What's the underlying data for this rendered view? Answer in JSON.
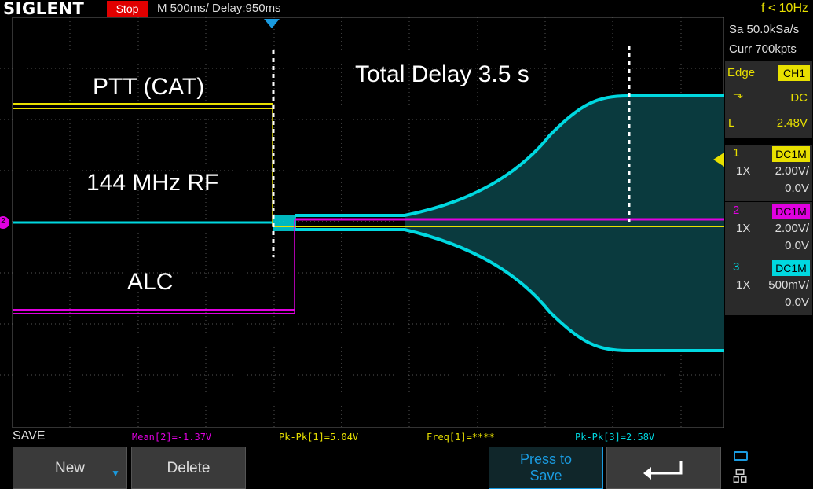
{
  "topbar": {
    "brand": "SIGLENT",
    "run_state": "Stop",
    "timebase": "M 500ms/  Delay:950ms",
    "trigger_freq": "f < 10Hz"
  },
  "acquisition": {
    "sample_rate": "Sa 50.0kSa/s",
    "memory_depth": "Curr 700kpts"
  },
  "trigger": {
    "type": "Edge",
    "source": "CH1",
    "coupling": "DC",
    "level_label": "L",
    "level": "2.48V"
  },
  "channels": [
    {
      "num": "1",
      "coupling": "DC1M",
      "probe": "1X",
      "vdiv": "2.00V/",
      "offset": "0.0V",
      "color": "#e8e000"
    },
    {
      "num": "2",
      "coupling": "DC1M",
      "probe": "1X",
      "vdiv": "2.00V/",
      "offset": "0.0V",
      "color": "#e000e0"
    },
    {
      "num": "3",
      "coupling": "DC1M",
      "probe": "1X",
      "vdiv": "500mV/",
      "offset": "0.0V",
      "color": "#00d8e0"
    }
  ],
  "annotations": {
    "ptt": "PTT (CAT)",
    "rf": "144 MHz RF",
    "alc": "ALC",
    "delay": "Total Delay 3.5 s"
  },
  "marker": {
    "ch2": "2"
  },
  "measurements": [
    {
      "text": "Mean[2]=-1.37V",
      "color": "#e000e0"
    },
    {
      "text": "Pk-Pk[1]=5.04V",
      "color": "#e8e000"
    },
    {
      "text": "Freq[1]=****",
      "color": "#e8e000"
    },
    {
      "text": "Pk-Pk[3]=2.58V",
      "color": "#00d8e0"
    }
  ],
  "menu": {
    "title": "SAVE",
    "new_label": "New",
    "delete_label": "Delete",
    "press_line1": "Press to",
    "press_line2": "Save"
  }
}
